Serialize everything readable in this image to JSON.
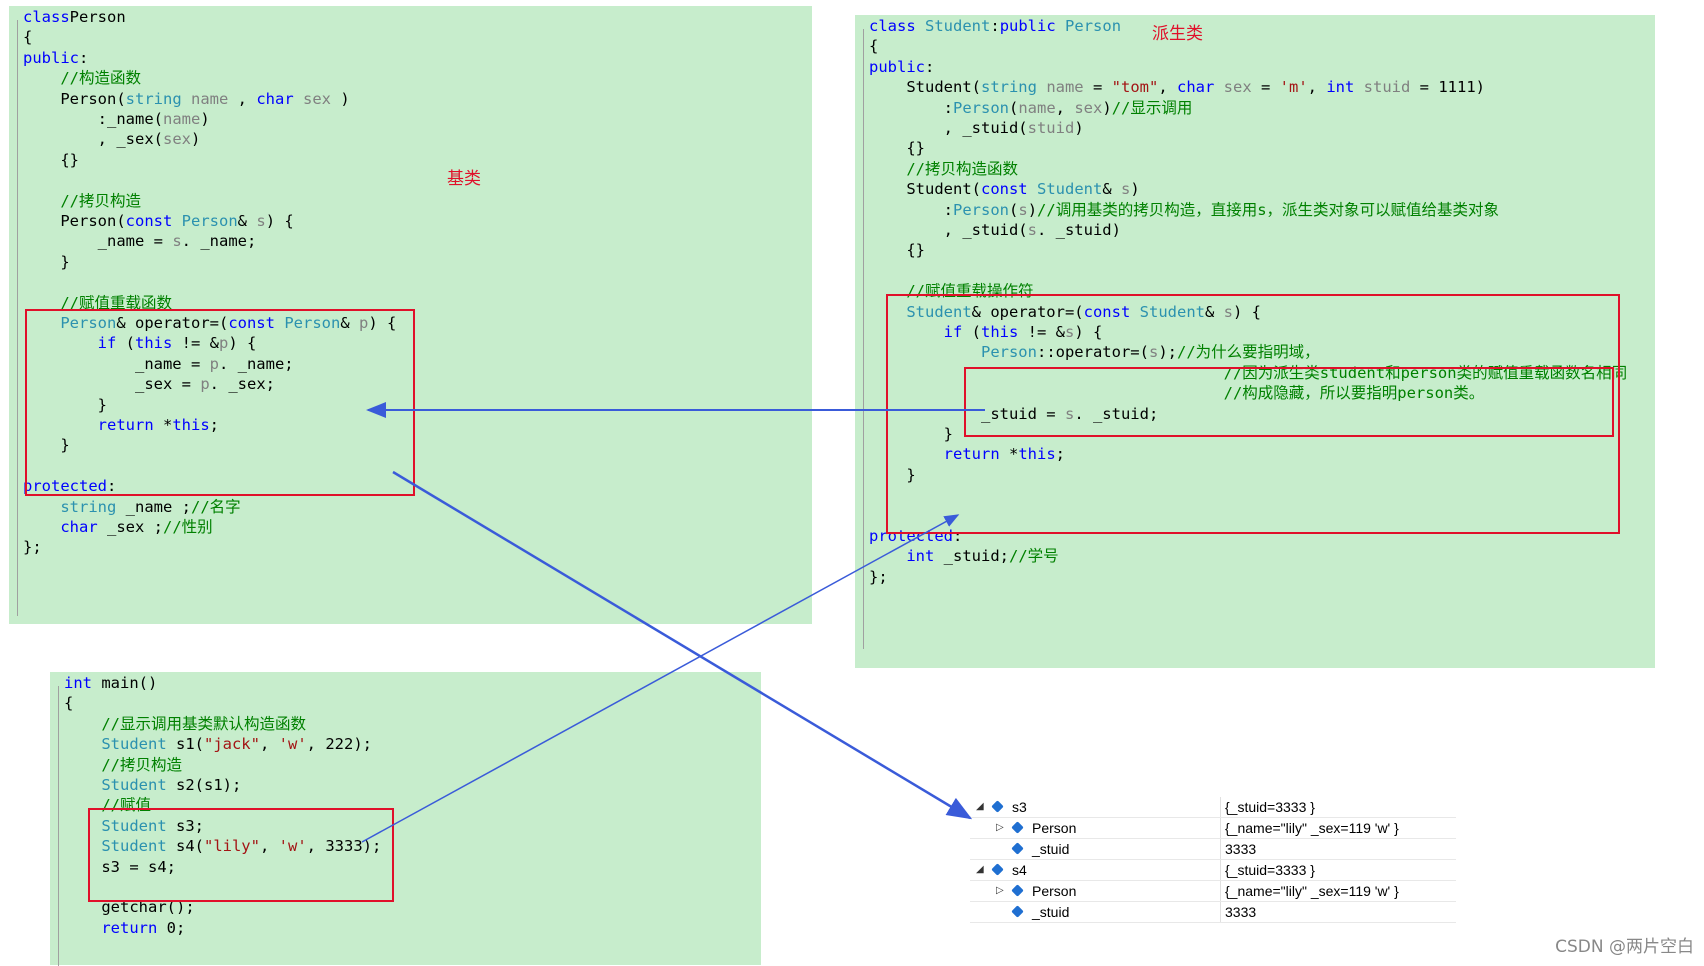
{
  "labels": {
    "base_class": "基类",
    "derived_class": "派生类"
  },
  "person_code": [
    [
      [
        "kw",
        "class"
      ],
      [
        "",
        "Person"
      ]
    ],
    [
      [
        "",
        "{"
      ]
    ],
    [
      [
        "kw",
        "public"
      ],
      [
        "",
        ":"
      ]
    ],
    [
      [
        "",
        "    "
      ],
      [
        "cm",
        "//构造函数"
      ]
    ],
    [
      [
        "",
        "    Person("
      ],
      [
        "ty",
        "string"
      ],
      [
        "pa",
        " name "
      ],
      [
        "",
        ", "
      ],
      [
        "kw",
        "char"
      ],
      [
        "pa",
        " sex "
      ],
      [
        "",
        ")"
      ]
    ],
    [
      [
        "",
        "        :_name("
      ],
      [
        "pa",
        "name"
      ],
      [
        "",
        ")"
      ]
    ],
    [
      [
        "",
        "        , _sex("
      ],
      [
        "pa",
        "sex"
      ],
      [
        "",
        ")"
      ]
    ],
    [
      [
        "",
        "    {}"
      ]
    ],
    [
      [
        "",
        ""
      ]
    ],
    [
      [
        "",
        "    "
      ],
      [
        "cm",
        "//拷贝构造"
      ]
    ],
    [
      [
        "",
        "    Person("
      ],
      [
        "kw",
        "const"
      ],
      [
        "",
        " "
      ],
      [
        "ty",
        "Person"
      ],
      [
        "",
        "& "
      ],
      [
        "pa",
        "s"
      ],
      [
        "",
        ") {"
      ]
    ],
    [
      [
        "",
        "        _name = "
      ],
      [
        "pa",
        "s"
      ],
      [
        "",
        ". _name;"
      ]
    ],
    [
      [
        "",
        "    }"
      ]
    ],
    [
      [
        "",
        ""
      ]
    ],
    [
      [
        "",
        "    "
      ],
      [
        "cm",
        "//赋值重载函数"
      ]
    ],
    [
      [
        "",
        "    "
      ],
      [
        "ty",
        "Person"
      ],
      [
        "",
        "& operator=("
      ],
      [
        "kw",
        "const"
      ],
      [
        "",
        " "
      ],
      [
        "ty",
        "Person"
      ],
      [
        "",
        "& "
      ],
      [
        "pa",
        "p"
      ],
      [
        "",
        ") {"
      ]
    ],
    [
      [
        "",
        "        "
      ],
      [
        "kw",
        "if"
      ],
      [
        "",
        " ("
      ],
      [
        "kw",
        "this"
      ],
      [
        "",
        " != &"
      ],
      [
        "pa",
        "p"
      ],
      [
        "",
        ") {"
      ]
    ],
    [
      [
        "",
        "            _name = "
      ],
      [
        "pa",
        "p"
      ],
      [
        "",
        ". _name;"
      ]
    ],
    [
      [
        "",
        "            _sex = "
      ],
      [
        "pa",
        "p"
      ],
      [
        "",
        ". _sex;"
      ]
    ],
    [
      [
        "",
        "        }"
      ]
    ],
    [
      [
        "",
        "        "
      ],
      [
        "kw",
        "return"
      ],
      [
        "",
        " *"
      ],
      [
        "kw",
        "this"
      ],
      [
        "",
        ";"
      ]
    ],
    [
      [
        "",
        "    }"
      ]
    ],
    [
      [
        "",
        ""
      ]
    ],
    [
      [
        "kw",
        "protected"
      ],
      [
        "",
        ":"
      ]
    ],
    [
      [
        "",
        "    "
      ],
      [
        "ty",
        "string"
      ],
      [
        "",
        " _name ;"
      ],
      [
        "cm",
        "//名字"
      ]
    ],
    [
      [
        "",
        "    "
      ],
      [
        "kw",
        "char"
      ],
      [
        "",
        " _sex ;"
      ],
      [
        "cm",
        "//性别"
      ]
    ],
    [
      [
        "",
        "};"
      ]
    ]
  ],
  "student_code": [
    [
      [
        "kw",
        "class"
      ],
      [
        "",
        " "
      ],
      [
        "ty",
        "Student"
      ],
      [
        "",
        ":"
      ],
      [
        "kw",
        "public"
      ],
      [
        "",
        " "
      ],
      [
        "ty",
        "Person"
      ]
    ],
    [
      [
        "",
        "{"
      ]
    ],
    [
      [
        "kw",
        "public"
      ],
      [
        "",
        ":"
      ]
    ],
    [
      [
        "",
        "    Student("
      ],
      [
        "ty",
        "string"
      ],
      [
        "pa",
        " name"
      ],
      [
        "",
        " = "
      ],
      [
        "st",
        "\"tom\""
      ],
      [
        "",
        ", "
      ],
      [
        "kw",
        "char"
      ],
      [
        "pa",
        " sex"
      ],
      [
        "",
        " = "
      ],
      [
        "st",
        "'m'"
      ],
      [
        "",
        ", "
      ],
      [
        "kw",
        "int"
      ],
      [
        "pa",
        " stuid"
      ],
      [
        "",
        " = 1111)"
      ]
    ],
    [
      [
        "",
        "        :"
      ],
      [
        "ty",
        "Person"
      ],
      [
        "",
        "("
      ],
      [
        "pa",
        "name"
      ],
      [
        "",
        ", "
      ],
      [
        "pa",
        "sex"
      ],
      [
        "",
        ")"
      ],
      [
        "cm",
        "//显示调用"
      ]
    ],
    [
      [
        "",
        "        , _stuid("
      ],
      [
        "pa",
        "stuid"
      ],
      [
        "",
        ")"
      ]
    ],
    [
      [
        "",
        "    {}"
      ]
    ],
    [
      [
        "",
        "    "
      ],
      [
        "cm",
        "//拷贝构造函数"
      ]
    ],
    [
      [
        "",
        "    Student("
      ],
      [
        "kw",
        "const"
      ],
      [
        "",
        " "
      ],
      [
        "ty",
        "Student"
      ],
      [
        "",
        "& "
      ],
      [
        "pa",
        "s"
      ],
      [
        "",
        ")"
      ]
    ],
    [
      [
        "",
        "        :"
      ],
      [
        "ty",
        "Person"
      ],
      [
        "",
        "("
      ],
      [
        "pa",
        "s"
      ],
      [
        "",
        ")"
      ],
      [
        "cm",
        "//调用基类的拷贝构造，直接用s，派生类对象可以赋值给基类对象"
      ]
    ],
    [
      [
        "",
        "        , _stuid("
      ],
      [
        "pa",
        "s"
      ],
      [
        "",
        ". _stuid)"
      ]
    ],
    [
      [
        "",
        "    {}"
      ]
    ],
    [
      [
        "",
        ""
      ]
    ],
    [
      [
        "",
        "    "
      ],
      [
        "cm",
        "//赋值重载操作符"
      ]
    ],
    [
      [
        "",
        "    "
      ],
      [
        "ty",
        "Student"
      ],
      [
        "",
        "& operator=("
      ],
      [
        "kw",
        "const"
      ],
      [
        "",
        " "
      ],
      [
        "ty",
        "Student"
      ],
      [
        "",
        "& "
      ],
      [
        "pa",
        "s"
      ],
      [
        "",
        ") {"
      ]
    ],
    [
      [
        "",
        "        "
      ],
      [
        "kw",
        "if"
      ],
      [
        "",
        " ("
      ],
      [
        "kw",
        "this"
      ],
      [
        "",
        " != &"
      ],
      [
        "pa",
        "s"
      ],
      [
        "",
        ") {"
      ]
    ],
    [
      [
        "",
        "            "
      ],
      [
        "ty",
        "Person"
      ],
      [
        "",
        "::operator=("
      ],
      [
        "pa",
        "s"
      ],
      [
        "",
        ");"
      ],
      [
        "cm",
        "//为什么要指明域，"
      ]
    ],
    [
      [
        "",
        "                                      "
      ],
      [
        "cm",
        "//因为派生类student和person类的赋值重载函数名相同"
      ]
    ],
    [
      [
        "",
        "                                      "
      ],
      [
        "cm",
        "//构成隐藏，所以要指明person类。"
      ]
    ],
    [
      [
        "",
        "            _stuid = "
      ],
      [
        "pa",
        "s"
      ],
      [
        "",
        ". _stuid;"
      ]
    ],
    [
      [
        "",
        "        }"
      ]
    ],
    [
      [
        "",
        "        "
      ],
      [
        "kw",
        "return"
      ],
      [
        "",
        " *"
      ],
      [
        "kw",
        "this"
      ],
      [
        "",
        ";"
      ]
    ],
    [
      [
        "",
        "    }"
      ]
    ],
    [
      [
        "",
        ""
      ]
    ],
    [
      [
        "",
        ""
      ]
    ],
    [
      [
        "kw",
        "protected"
      ],
      [
        "",
        ":"
      ]
    ],
    [
      [
        "",
        "    "
      ],
      [
        "kw",
        "int"
      ],
      [
        "",
        " _stuid;"
      ],
      [
        "cm",
        "//学号"
      ]
    ],
    [
      [
        "",
        "};"
      ]
    ]
  ],
  "main_code": [
    [
      [
        "kw",
        "int"
      ],
      [
        "",
        " main()"
      ]
    ],
    [
      [
        "",
        "{"
      ]
    ],
    [
      [
        "",
        "    "
      ],
      [
        "cm",
        "//显示调用基类默认构造函数"
      ]
    ],
    [
      [
        "",
        "    "
      ],
      [
        "ty",
        "Student"
      ],
      [
        "",
        " s1("
      ],
      [
        "st",
        "\"jack\""
      ],
      [
        "",
        ", "
      ],
      [
        "st",
        "'w'"
      ],
      [
        "",
        ", 222);"
      ]
    ],
    [
      [
        "",
        "    "
      ],
      [
        "cm",
        "//拷贝构造"
      ]
    ],
    [
      [
        "",
        "    "
      ],
      [
        "ty",
        "Student"
      ],
      [
        "",
        " s2(s1);"
      ]
    ],
    [
      [
        "",
        "    "
      ],
      [
        "cm",
        "//赋值"
      ]
    ],
    [
      [
        "",
        "    "
      ],
      [
        "ty",
        "Student"
      ],
      [
        "",
        " s3;"
      ]
    ],
    [
      [
        "",
        "    "
      ],
      [
        "ty",
        "Student"
      ],
      [
        "",
        " s4("
      ],
      [
        "st",
        "\"lily\""
      ],
      [
        "",
        ", "
      ],
      [
        "st",
        "'w'"
      ],
      [
        "",
        ", 3333);"
      ]
    ],
    [
      [
        "",
        "    s3 = s4;"
      ]
    ],
    [
      [
        "",
        ""
      ]
    ],
    [
      [
        "",
        "    getchar();"
      ]
    ],
    [
      [
        "",
        "    "
      ],
      [
        "kw",
        "return"
      ],
      [
        "",
        " 0;"
      ]
    ]
  ],
  "debugger": [
    {
      "name": "s3",
      "value": "{_stuid=3333 }",
      "level": 0,
      "expander": "expanded",
      "icon": "object-icon"
    },
    {
      "name": "Person",
      "value": "{_name=\"lily\" _sex=119 'w' }",
      "level": 1,
      "expander": "collapsed",
      "icon": "object-icon"
    },
    {
      "name": "_stuid",
      "value": "3333",
      "level": 1,
      "expander": "none",
      "icon": "field-icon"
    },
    {
      "name": "s4",
      "value": "{_stuid=3333 }",
      "level": 0,
      "expander": "expanded",
      "icon": "object-icon"
    },
    {
      "name": "Person",
      "value": "{_name=\"lily\" _sex=119 'w' }",
      "level": 1,
      "expander": "collapsed",
      "icon": "object-icon"
    },
    {
      "name": "_stuid",
      "value": "3333",
      "level": 1,
      "expander": "none",
      "icon": "field-icon"
    }
  ],
  "watermark": "CSDN @两片空白",
  "colors": {
    "panel": "#c7edcc",
    "highlight_box": "#e0102a",
    "arrow": "#3a5bd9"
  }
}
